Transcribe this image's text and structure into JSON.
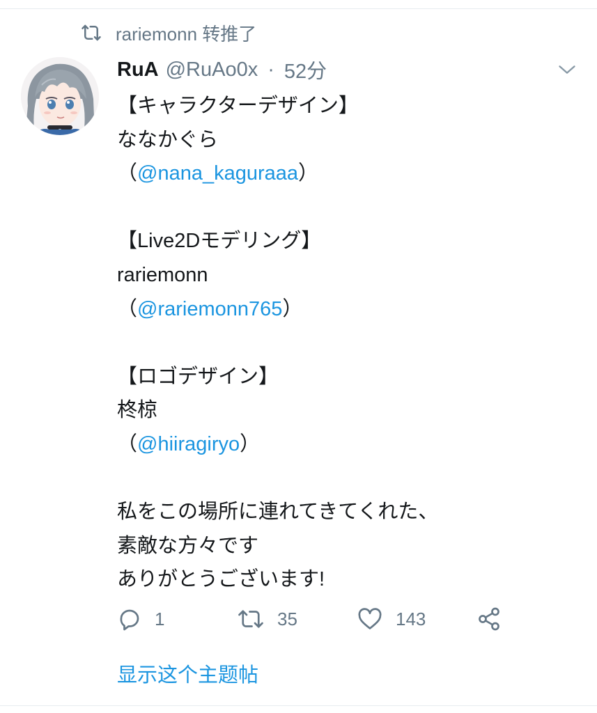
{
  "retweet_context": {
    "icon": "retweet-icon",
    "text": "rariemonn 转推了"
  },
  "tweet": {
    "author_name": "RuA",
    "author_handle": "@RuAo0x",
    "separator": "·",
    "time": "52分",
    "avatar_icon": "avatar",
    "menu_icon": "chevron-down-icon",
    "body": {
      "line1": "【キャラクターデザイン】",
      "line2": "ななかぐら",
      "line3_open": "（",
      "line3_mention": "@nana_kaguraaa",
      "line3_close": "）",
      "line5": "【Live2Dモデリング】",
      "line6": "rariemonn",
      "line7_open": "（",
      "line7_mention": "@rariemonn765",
      "line7_close": "）",
      "line9": "【ロゴデザイン】",
      "line10": "柊椋",
      "line11_open": "（",
      "line11_mention": "@hiiragiryo",
      "line11_close": "）",
      "line13": "私をこの場所に連れてきてくれた、",
      "line14": "素敵な方々です",
      "line15": "ありがとうございます!"
    },
    "actions": {
      "reply_count": "1",
      "retweet_count": "35",
      "like_count": "143"
    },
    "show_thread": "显示这个主题帖"
  },
  "colors": {
    "link": "#1b95e0",
    "secondary_text": "#657786",
    "primary_text": "#14171a",
    "divider": "#e6ecf0"
  }
}
